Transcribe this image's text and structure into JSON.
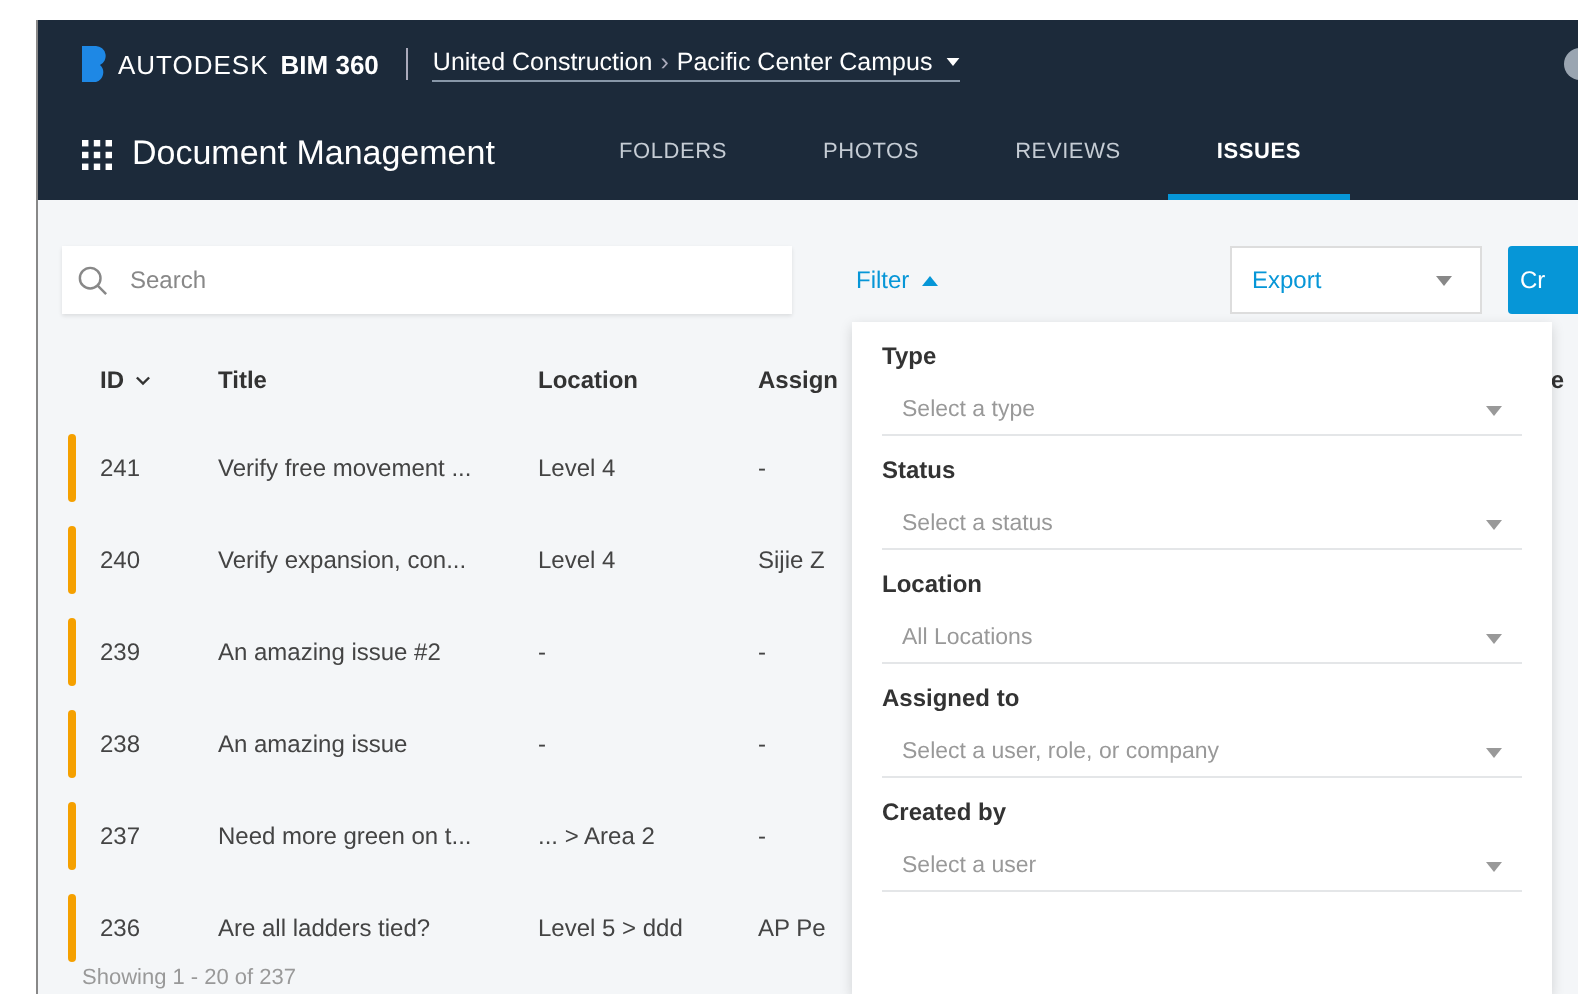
{
  "header": {
    "brand": {
      "company": "AUTODESK",
      "product": "BIM 360"
    },
    "breadcrumb": {
      "account": "United Construction",
      "separator": "›",
      "project": "Pacific Center Campus"
    },
    "module": "Document Management",
    "tabs": [
      {
        "label": "FOLDERS",
        "selected": false
      },
      {
        "label": "PHOTOS",
        "selected": false
      },
      {
        "label": "REVIEWS",
        "selected": false
      },
      {
        "label": "ISSUES",
        "selected": true
      }
    ]
  },
  "toolbar": {
    "search": {
      "placeholder": "Search"
    },
    "filter": "Filter",
    "export": "Export",
    "create": "Cr"
  },
  "table": {
    "columns": [
      "ID",
      "Title",
      "Location",
      "Assign",
      "e"
    ],
    "rows": [
      {
        "id": "241",
        "title": "Verify free movement ...",
        "location": "Level 4",
        "assigned": "-"
      },
      {
        "id": "240",
        "title": "Verify expansion, con...",
        "location": "Level 4",
        "assigned": "Sijie Z"
      },
      {
        "id": "239",
        "title": "An amazing issue #2",
        "location": "-",
        "assigned": "-"
      },
      {
        "id": "238",
        "title": "An amazing issue",
        "location": "-",
        "assigned": "-"
      },
      {
        "id": "237",
        "title": "Need more green on t...",
        "location": "... > Area 2",
        "assigned": "-"
      },
      {
        "id": "236",
        "title": "Are all ladders tied?",
        "location": "Level 5 > ddd",
        "assigned": "AP Pe"
      }
    ]
  },
  "footer": "Showing 1 - 20 of 237",
  "filter_panel": {
    "fields": [
      {
        "label": "Type",
        "placeholder": "Select a type"
      },
      {
        "label": "Status",
        "placeholder": "Select a status"
      },
      {
        "label": "Location",
        "placeholder": "All Locations"
      },
      {
        "label": "Assigned to",
        "placeholder": "Select a user, role, or company"
      },
      {
        "label": "Created by",
        "placeholder": "Select a user"
      }
    ]
  }
}
